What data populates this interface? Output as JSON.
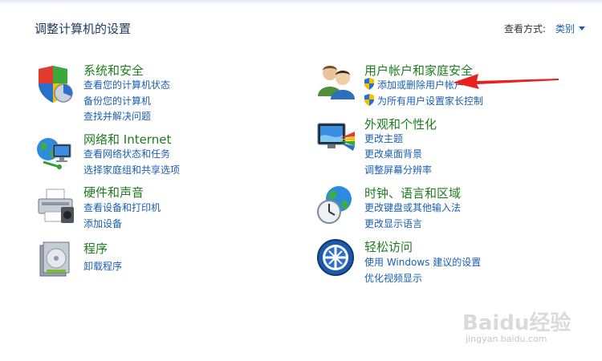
{
  "header": {
    "title": "调整计算机的设置",
    "view_by_label": "查看方式:",
    "view_by_value": "类别"
  },
  "categories": [
    {
      "title": "系统和安全",
      "icon": "shield-chart-icon",
      "links": [
        "查看您的计算机状态",
        "备份您的计算机",
        "查找并解决问题"
      ]
    },
    {
      "title": "网络和 Internet",
      "icon": "network-globe-icon",
      "links": [
        "查看网络状态和任务",
        "选择家庭组和共享选项"
      ]
    },
    {
      "title": "硬件和声音",
      "icon": "printer-icon",
      "links": [
        "查看设备和打印机",
        "添加设备"
      ]
    },
    {
      "title": "程序",
      "icon": "programs-icon",
      "links": [
        "卸载程序"
      ]
    },
    {
      "title": "用户帐户和家庭安全",
      "icon": "users-icon",
      "links": [
        "添加或删除用户帐户",
        "为所有用户设置家长控制"
      ]
    },
    {
      "title": "外观和个性化",
      "icon": "monitor-paint-icon",
      "links": [
        "更改主题",
        "更改桌面背景",
        "调整屏幕分辨率"
      ]
    },
    {
      "title": "时钟、语言和区域",
      "icon": "clock-globe-icon",
      "links": [
        "更改键盘或其他输入法",
        "更改显示语言"
      ]
    },
    {
      "title": "轻松访问",
      "icon": "ease-of-access-icon",
      "links": [
        "使用 Windows 建议的设置",
        "优化视频显示"
      ]
    }
  ],
  "watermark": {
    "text": "Baidu经验",
    "sub": "jingyan.baidu.com"
  },
  "colors": {
    "category_title": "#1d7d1d",
    "link": "#1a5fb4",
    "annotation_arrow": "#e8201e"
  }
}
